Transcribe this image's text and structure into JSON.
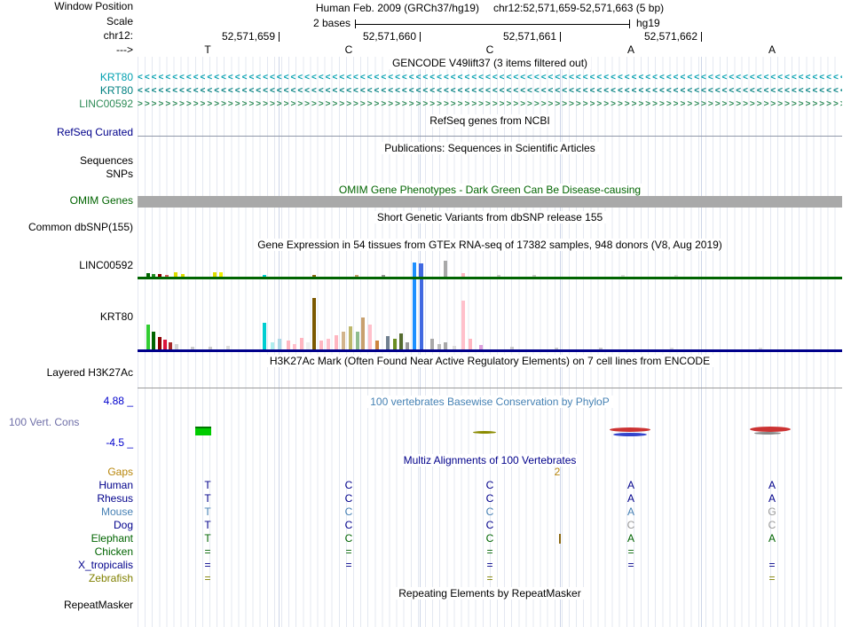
{
  "window": {
    "assembly_title": "Human Feb. 2009 (GRCh37/hg19)",
    "position": "chr12:52,571,659-52,571,663 (5 bp)"
  },
  "ruler": {
    "scale_label": "2 bases",
    "assembly": "hg19",
    "ticks": [
      "52,571,659",
      "52,571,660",
      "52,571,661",
      "52,571,662"
    ],
    "bases": [
      "T",
      "C",
      "C",
      "A",
      "A"
    ]
  },
  "left_labels": [
    {
      "id": "win",
      "text": "Window Position",
      "color": "#000000",
      "interactable": false
    },
    {
      "id": "scale",
      "text": "Scale",
      "color": "#000000",
      "interactable": false
    },
    {
      "id": "chr",
      "text": "chr12:",
      "color": "#000000",
      "interactable": false
    },
    {
      "id": "strand",
      "text": "--->",
      "color": "#000000",
      "interactable": false
    },
    {
      "id": "krt80a",
      "text": "KRT80",
      "color": "#00A0B0",
      "interactable": true
    },
    {
      "id": "krt80b",
      "text": "KRT80",
      "color": "#008080",
      "interactable": true
    },
    {
      "id": "linc",
      "text": "LINC00592",
      "color": "#2E8B57",
      "interactable": true
    },
    {
      "id": "refseq",
      "text": "RefSeq Curated",
      "color": "#00008B",
      "interactable": true
    },
    {
      "id": "seqs",
      "text": "Sequences",
      "color": "#000000",
      "interactable": true
    },
    {
      "id": "snps",
      "text": "SNPs",
      "color": "#000000",
      "interactable": true
    },
    {
      "id": "omim",
      "text": "OMIM Genes",
      "color": "#006400",
      "interactable": true
    },
    {
      "id": "dbsnp",
      "text": "Common dbSNP(155)",
      "color": "#000000",
      "interactable": true
    },
    {
      "id": "gtex_linc",
      "text": "LINC00592",
      "color": "#000000",
      "interactable": true
    },
    {
      "id": "gtex_krt",
      "text": "KRT80",
      "color": "#000000",
      "interactable": true
    },
    {
      "id": "h3k27ac",
      "text": "Layered H3K27Ac",
      "color": "#000000",
      "interactable": true
    },
    {
      "id": "cons_max",
      "text": "4.88 _",
      "color": "#0000CD",
      "interactable": false
    },
    {
      "id": "vert_cons",
      "text": "100 Vert. Cons",
      "color": "#6F6FA8",
      "interactable": true,
      "align": "left"
    },
    {
      "id": "cons_min",
      "text": "-4.5 _",
      "color": "#0000CD",
      "interactable": false
    },
    {
      "id": "gaps",
      "text": "Gaps",
      "color": "#B8860B",
      "interactable": true
    },
    {
      "id": "rmsk",
      "text": "RepeatMasker",
      "color": "#000000",
      "interactable": true
    }
  ],
  "tracks": {
    "gencode": {
      "title": "GENCODE V49lift37 (3 items filtered out)",
      "items": [
        {
          "gene": "KRT80",
          "glyph": "<",
          "color": "#00A0B0"
        },
        {
          "gene": "KRT80",
          "glyph": "<",
          "color": "#008080"
        },
        {
          "gene": "LINC00592",
          "glyph": ">",
          "color": "#2E8B57"
        }
      ]
    },
    "refseq": {
      "title": "RefSeq genes from NCBI"
    },
    "publications": {
      "title": "Publications: Sequences in Scientific Articles"
    },
    "omim": {
      "title": "OMIM Gene Phenotypes - Dark Green Can Be Disease-causing",
      "title_color": "#006400",
      "bar_color": "#A9A9A9"
    },
    "dbsnp": {
      "title": "Short Genetic Variants from dbSNP release 155"
    },
    "gtex": {
      "title": "Gene Expression in 54 tissues from GTEx RNA-seq of 17382 samples, 948 donors (V8, Aug 2019)",
      "charts": [
        {
          "gene": "LINC00592",
          "baseline_color": "#006400",
          "bars": [
            [
              10,
              4,
              "#006400"
            ],
            [
              16,
              3,
              "#228B22"
            ],
            [
              23,
              3,
              "#8B0000"
            ],
            [
              31,
              2,
              "#CD5C5C"
            ],
            [
              41,
              5,
              "#DDDD00"
            ],
            [
              49,
              3,
              "#DDDD00"
            ],
            [
              85,
              5,
              "#DDDD00"
            ],
            [
              92,
              5,
              "#EEEE00"
            ],
            [
              141,
              2,
              "#00CED1"
            ],
            [
              197,
              2,
              "#8B6914"
            ],
            [
              245,
              2,
              "#C8A06E"
            ],
            [
              275,
              2,
              "#999999"
            ],
            [
              310,
              15,
              "#1E90FF"
            ],
            [
              317,
              15,
              "#4169E1"
            ],
            [
              345,
              18,
              "#A9A9A9"
            ],
            [
              365,
              4,
              "#FFB6C1"
            ],
            [
              405,
              2,
              "#CCCCCC"
            ],
            [
              445,
              2,
              "#CCCCCC"
            ],
            [
              545,
              2,
              "#DDDDDD"
            ],
            [
              605,
              2,
              "#DDDDDD"
            ]
          ]
        },
        {
          "gene": "KRT80",
          "baseline_color": "#00008B",
          "bars": [
            [
              10,
              28,
              "#32CD32"
            ],
            [
              16,
              20,
              "#006400"
            ],
            [
              23,
              14,
              "#8B0000"
            ],
            [
              29,
              11,
              "#DC143C"
            ],
            [
              35,
              8,
              "#A52A2A"
            ],
            [
              42,
              6,
              "#D3D3D3"
            ],
            [
              60,
              3,
              "#CCCCCC"
            ],
            [
              80,
              3,
              "#CCCCCC"
            ],
            [
              100,
              4,
              "#DDDDDD"
            ],
            [
              141,
              30,
              "#00CED1"
            ],
            [
              150,
              8,
              "#AFEEEE"
            ],
            [
              158,
              12,
              "#ADD8E6"
            ],
            [
              168,
              10,
              "#FFB6C1"
            ],
            [
              175,
              6,
              "#FFC0CB"
            ],
            [
              183,
              13,
              "#FFB6C1"
            ],
            [
              190,
              8,
              "#EEEEEE"
            ],
            [
              197,
              58,
              "#7B5800"
            ],
            [
              205,
              10,
              "#FFB6C1"
            ],
            [
              213,
              12,
              "#FFC0CB"
            ],
            [
              222,
              16,
              "#FFB6C1"
            ],
            [
              230,
              20,
              "#D2B48C"
            ],
            [
              238,
              26,
              "#BDB76B"
            ],
            [
              246,
              20,
              "#8FBC8F"
            ],
            [
              252,
              36,
              "#C8A06E"
            ],
            [
              260,
              28,
              "#FFC0CB"
            ],
            [
              268,
              10,
              "#CD853F"
            ],
            [
              280,
              15,
              "#708090"
            ],
            [
              288,
              12,
              "#6B8E23"
            ],
            [
              295,
              18,
              "#556B2F"
            ],
            [
              302,
              8,
              "#999999"
            ],
            [
              310,
              98,
              "#1E90FF"
            ],
            [
              318,
              97,
              "#4169E1"
            ],
            [
              330,
              12,
              "#A9A9A9"
            ],
            [
              338,
              6,
              "#BBBBBB"
            ],
            [
              345,
              8,
              "#A9A9A9"
            ],
            [
              355,
              4,
              "#DDDDDD"
            ],
            [
              365,
              55,
              "#FFC0CB"
            ],
            [
              373,
              12,
              "#FFB6C1"
            ],
            [
              385,
              5,
              "#DDA0DD"
            ],
            [
              420,
              3,
              "#CCCCCC"
            ],
            [
              470,
              2,
              "#CCCCCC"
            ],
            [
              520,
              2,
              "#CCCCCC"
            ],
            [
              600,
              2,
              "#DDDDDD"
            ],
            [
              700,
              2,
              "#DDDDDD"
            ]
          ]
        }
      ]
    },
    "h3k27ac": {
      "title": "H3K27Ac Mark (Often Found Near Active Regulatory Elements) on 7 cell lines from ENCODE"
    },
    "phylop": {
      "title": "100 vertebrates Basewise Conservation by PhyloP",
      "title_color": "#4682B4",
      "axis_max": "4.88 _",
      "axis_min": "-4.5 _",
      "marks": [
        [
          65,
          483,
          18,
          8,
          "#00CC00",
          "0"
        ],
        [
          65,
          481,
          18,
          2,
          "#007700",
          "0"
        ],
        [
          378,
          486,
          26,
          3,
          "#8B8B00",
          "50%"
        ],
        [
          532,
          482,
          46,
          5,
          "#CC3333",
          "50%"
        ],
        [
          536,
          488,
          38,
          4,
          "#3344CC",
          "50%"
        ],
        [
          690,
          481,
          46,
          6,
          "#CC3333",
          "50%"
        ],
        [
          695,
          487,
          30,
          3,
          "#888888",
          "50%"
        ]
      ]
    },
    "multiz": {
      "title": "Multiz Alignments of 100 Vertebrates",
      "title_color": "#00008B",
      "gap_row": {
        "label": "Gaps",
        "value": "2",
        "color": "#B8860B"
      },
      "insert_tick_color": "#8B6914",
      "rows": [
        {
          "species": "Human",
          "color": "#00008B",
          "cells": [
            "T",
            "C",
            "C",
            "A",
            "A"
          ],
          "dim": []
        },
        {
          "species": "Rhesus",
          "color": "#00008B",
          "cells": [
            "T",
            "C",
            "C",
            "A",
            "A"
          ],
          "dim": []
        },
        {
          "species": "Mouse",
          "color": "#4680B4",
          "cells": [
            "T",
            "C",
            "C",
            "A",
            "G"
          ],
          "dim": [
            4
          ]
        },
        {
          "species": "Dog",
          "color": "#00008B",
          "cells": [
            "T",
            "C",
            "C",
            "C",
            "C"
          ],
          "dim": [
            3,
            4
          ]
        },
        {
          "species": "Elephant",
          "color": "#006400",
          "cells": [
            "T",
            "C",
            "C",
            "A",
            "A"
          ],
          "dim": [],
          "insert_after": 2
        },
        {
          "species": "Chicken",
          "color": "#006400",
          "cells": [
            "=",
            "=",
            "=",
            "=",
            ""
          ],
          "dim": []
        },
        {
          "species": "X_tropicalis",
          "color": "#00008B",
          "cells": [
            "=",
            "=",
            "=",
            "=",
            "="
          ],
          "dim": []
        },
        {
          "species": "Zebrafish",
          "color": "#808000",
          "cells": [
            "=",
            "",
            "=",
            "",
            "="
          ],
          "dim": []
        }
      ]
    },
    "repeatmasker": {
      "title": "Repeating Elements by RepeatMasker"
    }
  }
}
